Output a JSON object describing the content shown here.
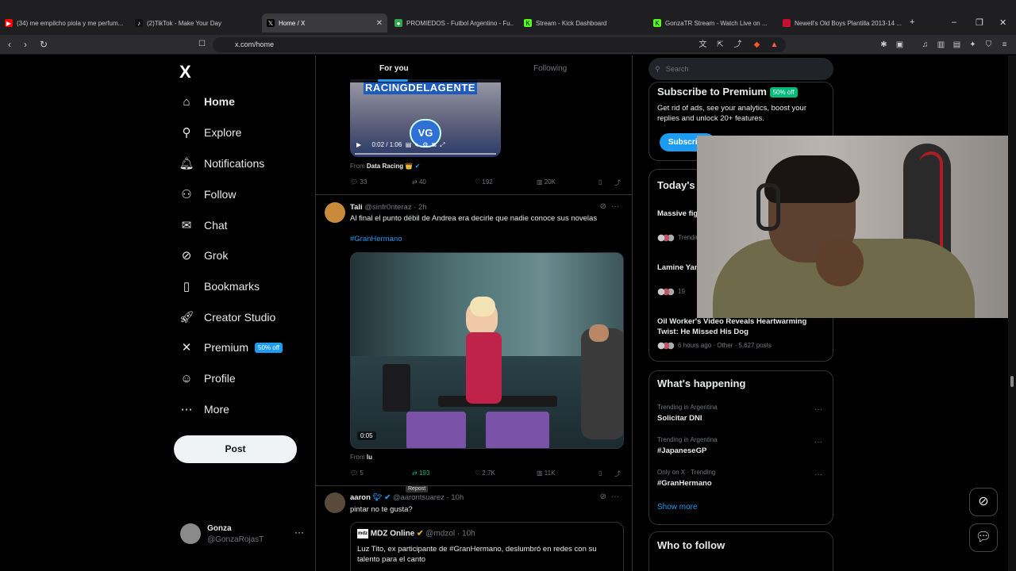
{
  "browser": {
    "tabs": [
      {
        "title": "(34) me empilcho piola y me perfum...",
        "icon_color": "#ff0000"
      },
      {
        "title": "(2)TikTok - Make Your Day",
        "icon_color": "#111111"
      },
      {
        "title": "Home / X",
        "icon_color": "#000000",
        "active": true
      },
      {
        "title": "PROMIEDOS - Futbol Argentino - Fu...",
        "icon_color": "#2fa84f"
      },
      {
        "title": "Stream - Kick Dashboard",
        "icon_color": "#53fc18"
      },
      {
        "title": "GonzaTR Stream - Watch Live on ...",
        "icon_color": "#53fc18"
      },
      {
        "title": "Newell's Old Boys Plantilla 2013-14 ...",
        "icon_color": "#c8102e"
      }
    ],
    "url": "x.com/home"
  },
  "nav": {
    "logo": "X",
    "items": [
      {
        "label": "Home",
        "icon": "home-icon"
      },
      {
        "label": "Explore",
        "icon": "search-icon"
      },
      {
        "label": "Notifications",
        "icon": "bell-icon"
      },
      {
        "label": "Follow",
        "icon": "person-add-icon"
      },
      {
        "label": "Chat",
        "icon": "mail-icon"
      },
      {
        "label": "Grok",
        "icon": "grok-icon"
      },
      {
        "label": "Bookmarks",
        "icon": "bookmark-icon"
      },
      {
        "label": "Creator Studio",
        "icon": "rocket-icon"
      },
      {
        "label": "Premium",
        "icon": "x-icon",
        "badge": "50% off"
      },
      {
        "label": "Profile",
        "icon": "person-icon"
      },
      {
        "label": "More",
        "icon": "more-circle-icon"
      }
    ],
    "post_button": "Post",
    "account": {
      "name": "Gonza",
      "handle": "@GonzaRojasT"
    }
  },
  "feed": {
    "tabs": [
      "For you",
      "Following"
    ],
    "tweet1": {
      "overlay_text": "RACINGDELAGENTE",
      "logo_text": "VG",
      "video_time": "0:02 / 1:06",
      "from_label": "From",
      "from_name": "Data Racing 👑",
      "replies": "33",
      "reposts": "40",
      "likes": "192",
      "views": "20K"
    },
    "tweet2": {
      "name": "Tali",
      "handle": "@sinfr0nteraz",
      "time": "· 2h",
      "text": "Al final el punto débil de Andrea era decirle que nadie conoce sus novelas",
      "hashtag": "#GranHermano",
      "duration": "0:05",
      "from_label": "From",
      "from_name": "lu",
      "replies": "5",
      "reposts": "193",
      "likes": "2.7K",
      "views": "11K",
      "tooltip": "Repost"
    },
    "tweet3": {
      "name": "aaron",
      "handle": "@aarontsuarez",
      "time": "· 10h",
      "text": "pintar no te gusta?",
      "quote": {
        "name": "MDZ Online",
        "handle": "@mdzol",
        "time": "· 10h",
        "text": "Luz Tito, ex participante de #GranHermano, deslumbró en redes con su talento para el canto"
      }
    }
  },
  "sidebar": {
    "search_placeholder": "Search",
    "premium": {
      "title": "Subscribe to Premium",
      "pill": "50% off",
      "text": "Get rid of ads, see your analytics, boost your replies and unlock 20+ features.",
      "button": "Subscribe"
    },
    "news": {
      "title": "Today's News",
      "items": [
        {
          "title": "Massive fight and Atlas",
          "meta": "Trending"
        },
        {
          "title": "Lamine Yamal Blaugrana",
          "meta": "19"
        },
        {
          "title": "Oil Worker's Video Reveals Heartwarming Twist: He Missed His Dog",
          "meta": "6 hours ago · Other · 5,627 posts"
        }
      ]
    },
    "happening": {
      "title": "What's happening",
      "trends": [
        {
          "context": "Trending in Argentina",
          "topic": "Solicitar DNI"
        },
        {
          "context": "Trending in Argentina",
          "topic": "#JapaneseGP"
        },
        {
          "context": "Only on X · Trending",
          "topic": "#GranHermano"
        }
      ],
      "show_more": "Show more"
    },
    "who_to_follow": "Who to follow"
  }
}
